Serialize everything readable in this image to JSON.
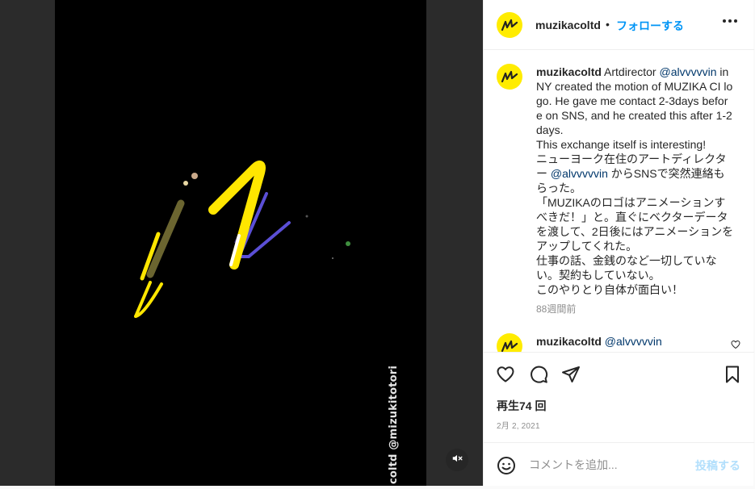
{
  "header": {
    "username": "muzikacoltd",
    "separator": "•",
    "follow_label": "フォローする"
  },
  "caption": {
    "username": "muzikacoltd",
    "text_1": " Artdirector ",
    "mention_1": "@alvvvvvin",
    "text_2": " in NY created the motion of MUZIKA CI logo. He gave me contact 2-3days before on SNS, and he created this after 1-2 days.",
    "text_3": "This exchange itself is interesting!",
    "text_4": "ニューヨーク在住のアートディレクター ",
    "mention_2": "@alvvvvvin",
    "text_5": " からSNSで突然連絡もらった。",
    "text_6": "「MUZIKAのロゴはアニメーションすべきだ！」と。直ぐにベクターデータを渡して、2日後にはアニメーションをアップしてくれた。",
    "text_7": "仕事の話、金銭のなど一切していない。契約もしていない。",
    "text_8": "このやりとり自体が面白い！",
    "time_ago": "88週間前"
  },
  "reply": {
    "username": "muzikacoltd",
    "mention": "@alvvvvvin"
  },
  "actions": {
    "views": "再生74 回",
    "date": "2月 2, 2021"
  },
  "comment_bar": {
    "placeholder": "コメントを追加...",
    "post_label": "投稿する"
  },
  "video": {
    "watermark": "coltd @mizukitotori"
  },
  "colors": {
    "accent": "#0095f6",
    "avatar_bg": "#ffec00",
    "mention": "#00376b",
    "logo_yellow": "#ffe600",
    "logo_purple": "#5b4fd6"
  },
  "icons": {
    "like": "heart-icon",
    "comment": "comment-icon",
    "share": "paper-plane-icon",
    "save": "bookmark-icon",
    "emoji": "smiley-icon",
    "mute": "speaker-muted-icon",
    "more": "more-options-icon"
  }
}
